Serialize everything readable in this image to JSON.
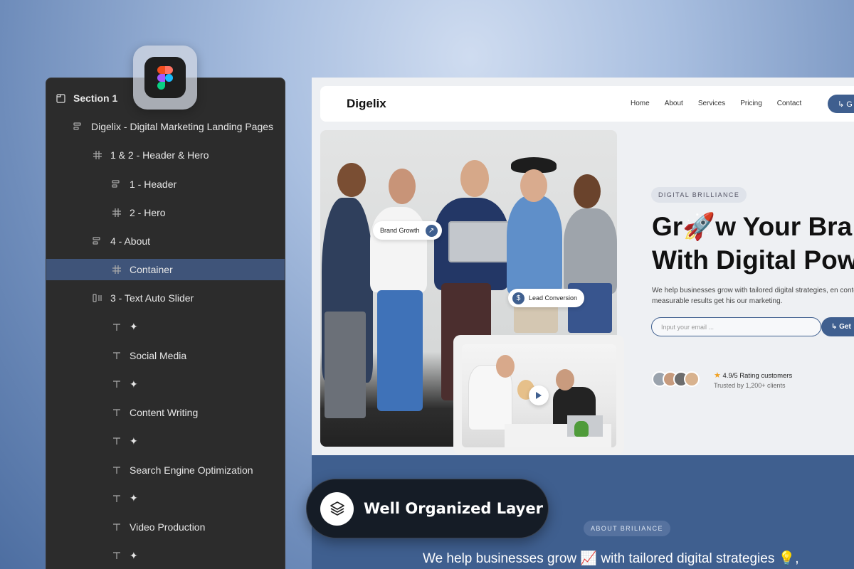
{
  "layers": {
    "items": [
      {
        "label": "Section 1",
        "icon": "section-icon",
        "indent": 0
      },
      {
        "label": "Digelix - Digital Marketing Landing Pages",
        "icon": "layout-icon",
        "indent": 1
      },
      {
        "label": "1 & 2 - Header & Hero",
        "icon": "frame-icon",
        "indent": 2
      },
      {
        "label": "1 - Header",
        "icon": "layout-icon",
        "indent": 3
      },
      {
        "label": "2 - Hero",
        "icon": "frame-icon",
        "indent": 3
      },
      {
        "label": "4 - About",
        "icon": "layout-icon",
        "indent": 2
      },
      {
        "label": "Container",
        "icon": "frame-icon",
        "indent": 3,
        "selected": true
      },
      {
        "label": "3 - Text Auto Slider",
        "icon": "auto-layout-icon",
        "indent": 2
      },
      {
        "label": "✦",
        "icon": "text-icon",
        "indent": 3
      },
      {
        "label": "Social Media",
        "icon": "text-icon",
        "indent": 3
      },
      {
        "label": "✦",
        "icon": "text-icon",
        "indent": 3
      },
      {
        "label": "Content Writing",
        "icon": "text-icon",
        "indent": 3
      },
      {
        "label": "✦",
        "icon": "text-icon",
        "indent": 3
      },
      {
        "label": "Search Engine Optimization",
        "icon": "text-icon",
        "indent": 3
      },
      {
        "label": "✦",
        "icon": "text-icon",
        "indent": 3
      },
      {
        "label": "Video Production",
        "icon": "text-icon",
        "indent": 3
      },
      {
        "label": "✦",
        "icon": "text-icon",
        "indent": 3
      }
    ]
  },
  "site": {
    "brand": "Digelix",
    "nav": [
      "Home",
      "About",
      "Services",
      "Pricing",
      "Contact"
    ],
    "header_cta": "↳ G",
    "pills": {
      "brand_growth": "Brand Growth",
      "lead_conversion": "Lead Conversion"
    },
    "hero": {
      "tag": "DIGITAL BRILLIANCE",
      "title_line1": "Gr🚀w Your Bra",
      "title_line2": "With Digital Pow",
      "description": "We help businesses grow with tailored digital strategies, en content, &  measurable results get his our marketing.",
      "email_placeholder": "Input your email ...",
      "email_button": "↳ Get",
      "rating": "4.9/5 Rating customers",
      "trusted": "Trusted by 1,200+ clients"
    },
    "about": {
      "tag": "ABOUT BRILIANCE",
      "text": "We help businesses grow 📈 with tailored digital strategies 💡,"
    }
  },
  "feature_badge": {
    "label": "Well Organized Layer",
    "icon": "layers-icon"
  },
  "colors": {
    "accent": "#3f5f8f",
    "panel": "#2c2c2c",
    "selected_row": "#3f5479",
    "badge_bg": "#151c26"
  }
}
